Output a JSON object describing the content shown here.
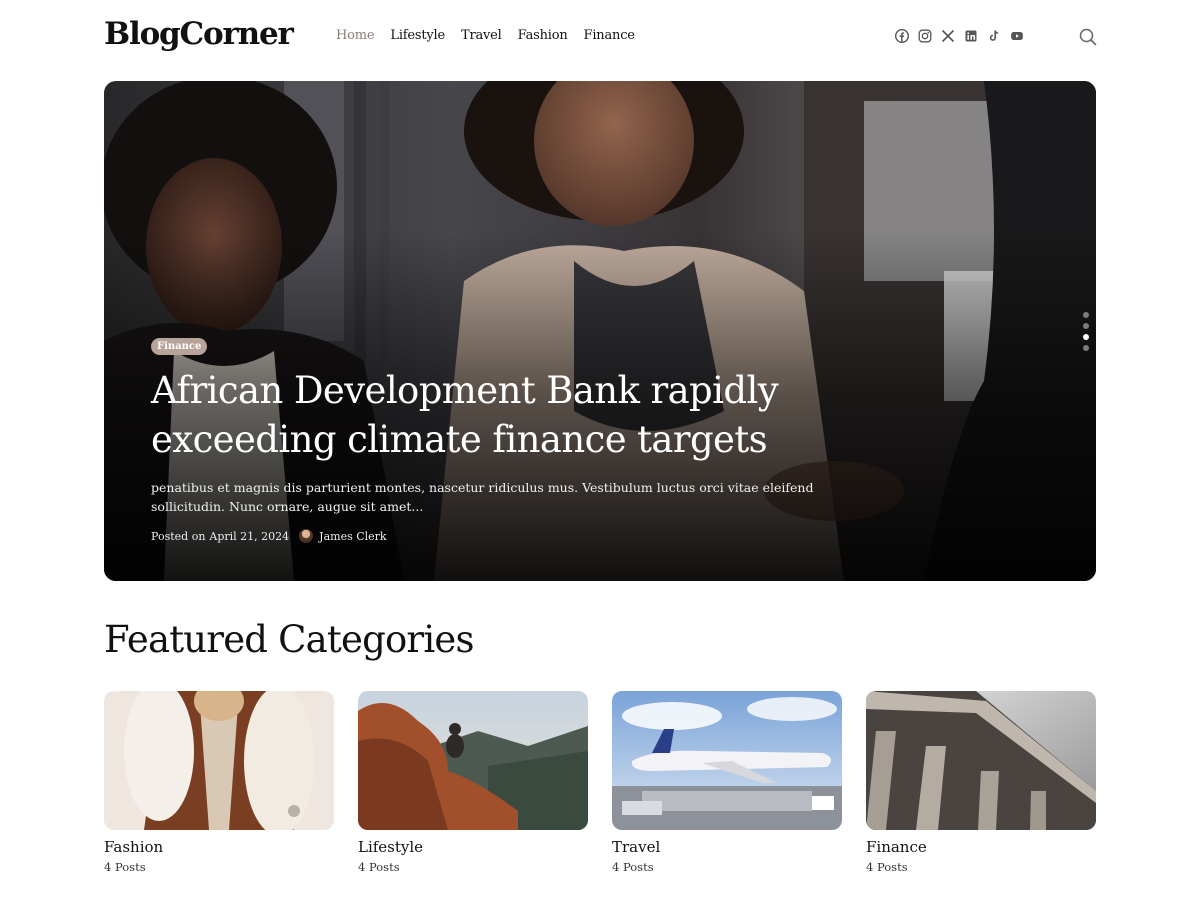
{
  "header": {
    "logo": "BlogCorner",
    "nav": [
      "Home",
      "Lifestyle",
      "Travel",
      "Fashion",
      "Finance"
    ],
    "active_nav": "Home",
    "social_icons": [
      "facebook-icon",
      "instagram-icon",
      "x-icon",
      "linkedin-icon",
      "tiktok-icon",
      "youtube-icon"
    ],
    "search_icon": "search-icon"
  },
  "hero": {
    "category": "Finance",
    "title": "African Development Bank rapidly exceeding climate finance targets",
    "excerpt": "penatibus et magnis dis parturient montes, nascetur ridiculus mus. Vestibulum luctus orci vitae eleifend sollicitudin. Nunc ornare, augue sit amet...",
    "posted_on": "Posted on",
    "date": "April 21, 2024",
    "author": "James Clerk",
    "slides": 4,
    "active_slide": 3
  },
  "featured": {
    "title": "Featured Categories",
    "categories": [
      {
        "name": "Fashion",
        "count": "4 Posts"
      },
      {
        "name": "Lifestyle",
        "count": "4 Posts"
      },
      {
        "name": "Travel",
        "count": "4 Posts"
      },
      {
        "name": "Finance",
        "count": "4 Posts"
      }
    ]
  },
  "colors": {
    "badge": "#b8a39a",
    "active_nav": "#8a7d78",
    "text": "#111111"
  }
}
